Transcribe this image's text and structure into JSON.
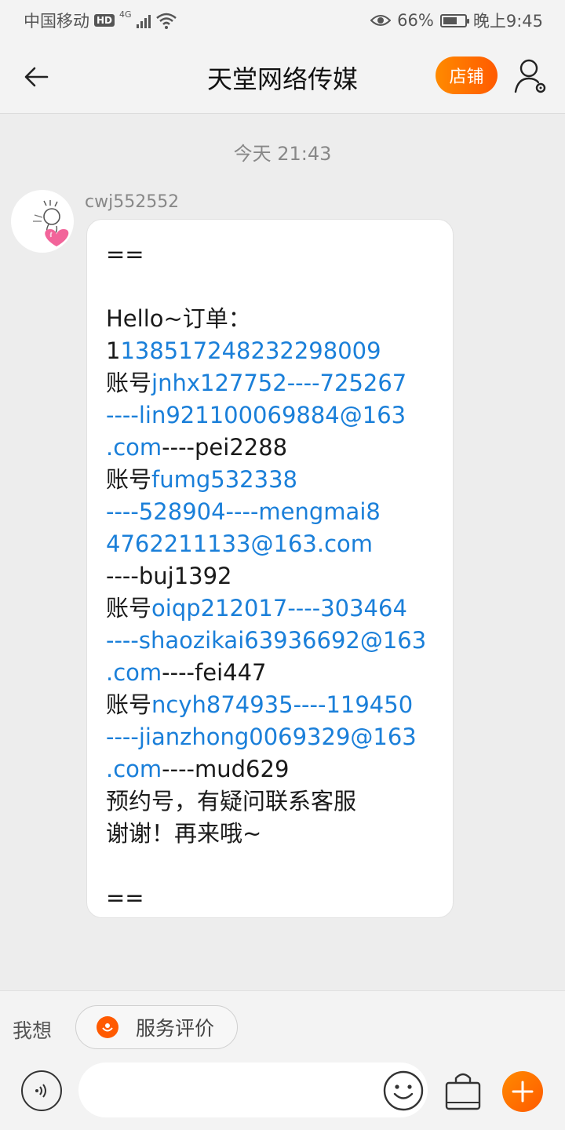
{
  "status_bar": {
    "carrier": "中国移动",
    "hd": "HD",
    "network": "4G",
    "battery_percent": "66%",
    "battery_level": 0.66,
    "time": "晚上9:45"
  },
  "header": {
    "title": "天堂网络传媒",
    "shop_label": "店铺"
  },
  "chat": {
    "timestamp": "今天  21:43",
    "sender": "cwj552552",
    "message_lines": [
      [
        {
          "t": "=="
        }
      ],
      [],
      [
        {
          "t": "Hello~订单："
        }
      ],
      [
        {
          "t": "1"
        },
        {
          "t": "1385172482322980​09",
          "link": true
        }
      ],
      [
        {
          "t": "账号"
        },
        {
          "t": "jnhx127752----725267",
          "link": true
        }
      ],
      [
        {
          "t": "----lin921100069884@163",
          "link": true
        }
      ],
      [
        {
          "t": ".com",
          "link": true
        },
        {
          "t": "----pei2288"
        }
      ],
      [
        {
          "t": "账号"
        },
        {
          "t": "fumg532338",
          "link": true
        }
      ],
      [
        {
          "t": "----528904----mengmai8",
          "link": true
        }
      ],
      [
        {
          "t": "4762211133@163.com",
          "link": true
        }
      ],
      [
        {
          "t": "----buj1392"
        }
      ],
      [
        {
          "t": "账号"
        },
        {
          "t": "oiqp212017----303464",
          "link": true
        }
      ],
      [
        {
          "t": "----shaozikai63936692@163",
          "link": true
        }
      ],
      [
        {
          "t": ".com",
          "link": true
        },
        {
          "t": "----fei447"
        }
      ],
      [
        {
          "t": "账号"
        },
        {
          "t": "ncyh874935----119450",
          "link": true
        }
      ],
      [
        {
          "t": "----jianzhong0069329@163",
          "link": true
        }
      ],
      [
        {
          "t": ".com",
          "link": true
        },
        {
          "t": "----mud629"
        }
      ],
      [
        {
          "t": "预约号，有疑问联系客服"
        }
      ],
      [
        {
          "t": "谢谢！再来哦~"
        }
      ],
      [],
      [
        {
          "t": "=="
        }
      ]
    ]
  },
  "quick_bar": {
    "label": "我想",
    "chip_label": "服务评价"
  },
  "input_bar": {
    "placeholder": ""
  },
  "colors": {
    "accent": "#ff6a00",
    "link": "#1a7fd9"
  }
}
